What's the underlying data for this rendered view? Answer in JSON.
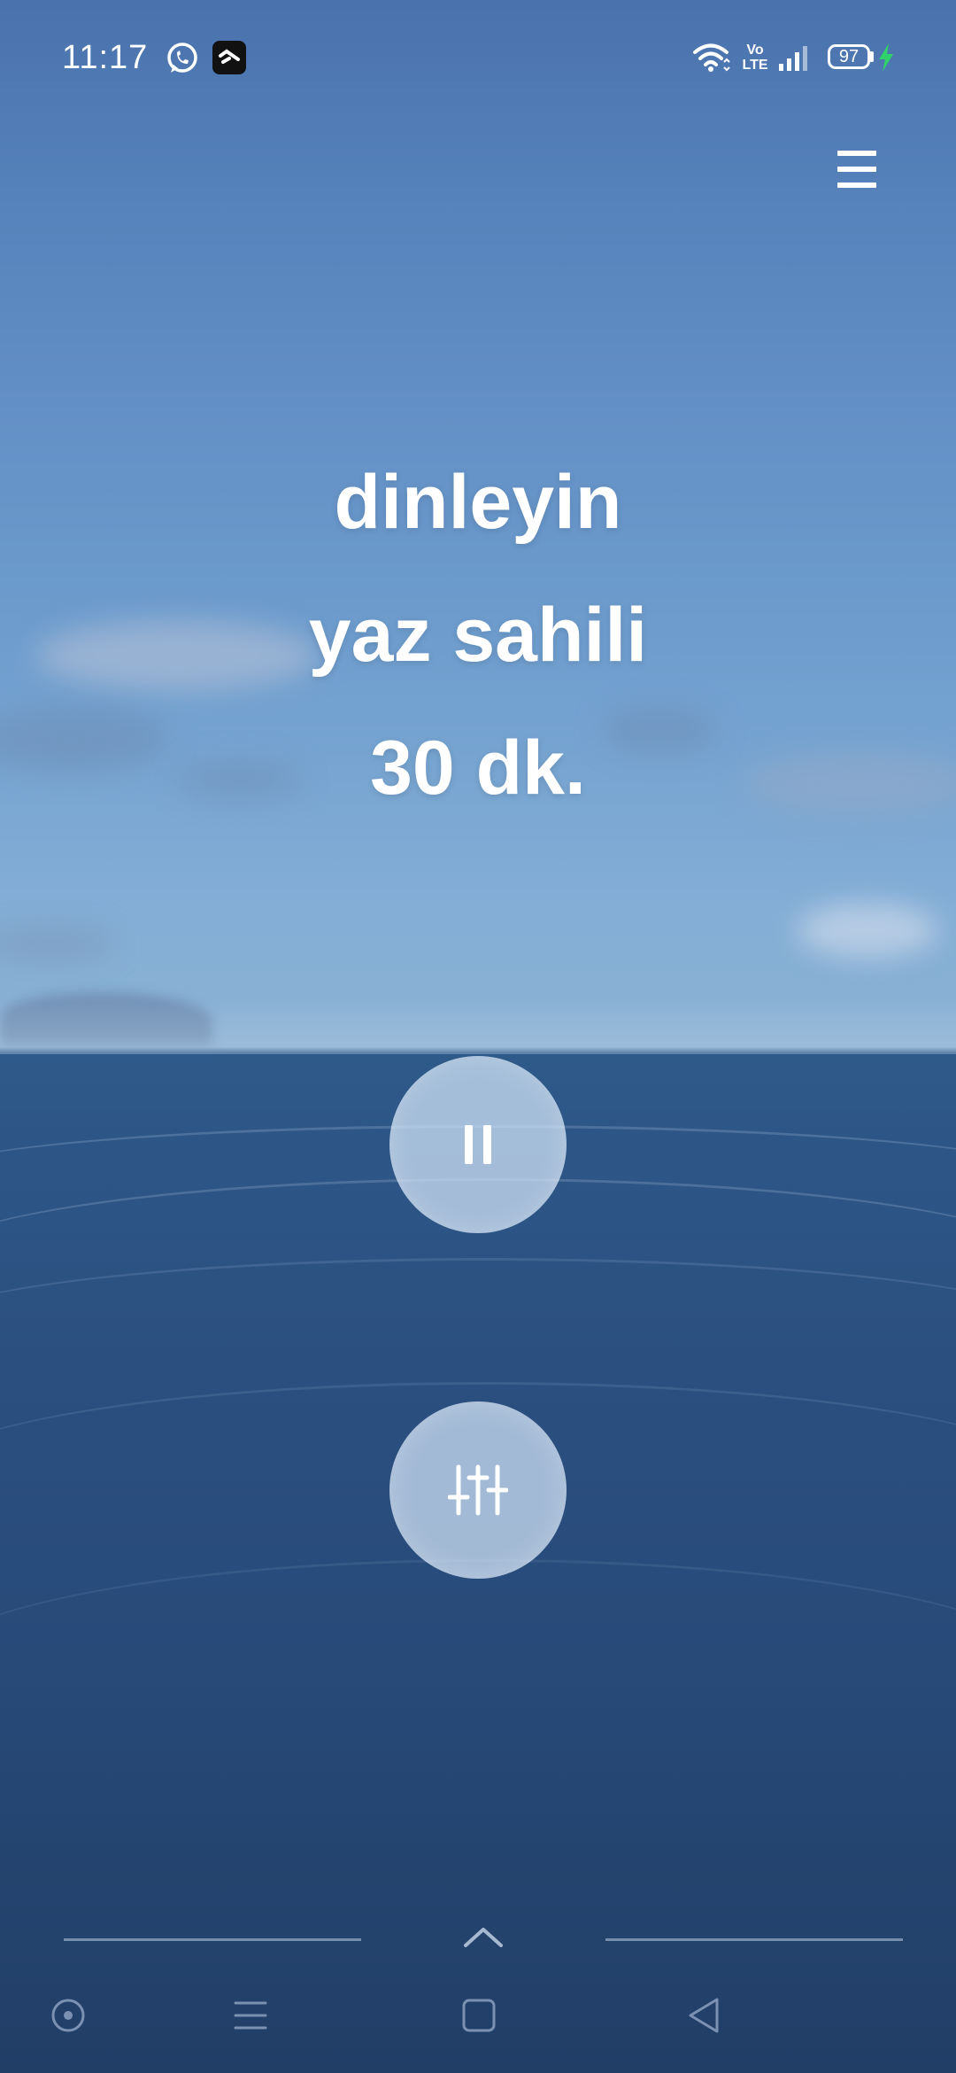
{
  "status_bar": {
    "time": "11:17",
    "battery_level": "97",
    "network_label_top": "Vo",
    "network_label_bottom": "LTE",
    "notification_icons": [
      "whatsapp-icon",
      "app-notification-icon"
    ],
    "system_icons": [
      "wifi-icon",
      "volte-icon",
      "signal-icon",
      "battery-icon",
      "charging-icon"
    ],
    "charging_color": "#2fd36a"
  },
  "header": {
    "menu_icon": "hamburger-menu-icon"
  },
  "player": {
    "line1": "dinleyin",
    "line2": "yaz sahili",
    "line3": "30 dk.",
    "pause_icon": "pause-icon",
    "mixer_icon": "sliders-icon"
  },
  "bottom_nav": {
    "expand_icon": "chevron-up-icon",
    "buttons": [
      "assistant-circle-icon",
      "menu-lines-icon",
      "home-square-icon",
      "back-triangle-icon"
    ]
  },
  "colors": {
    "sky_top": "#4a72ad",
    "sea": "#2c5282",
    "text": "#ffffff",
    "button_fill": "#d2e4f8"
  }
}
